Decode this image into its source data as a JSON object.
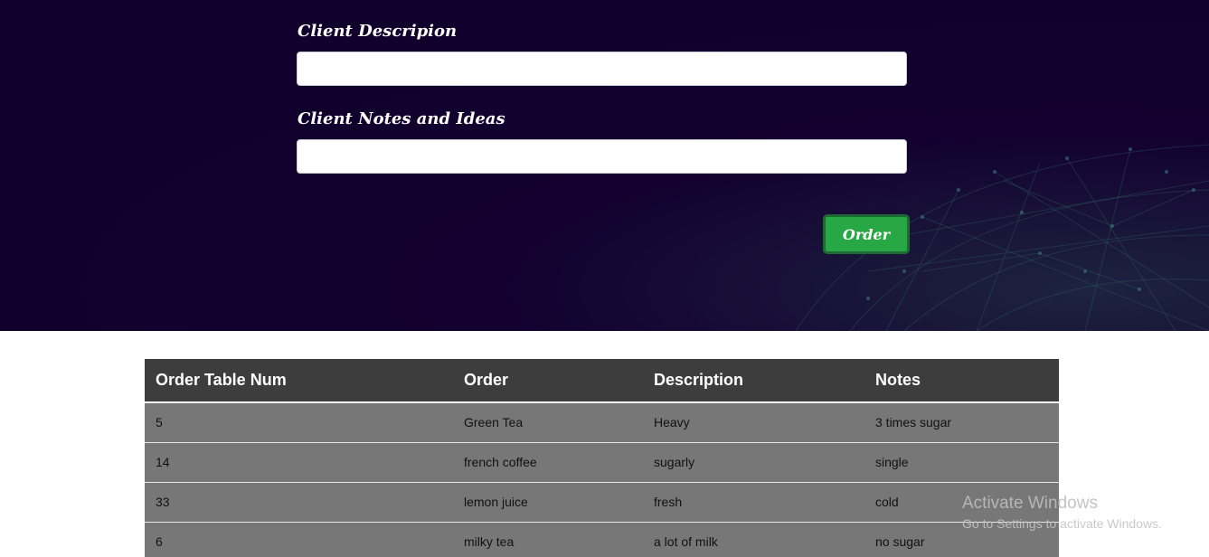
{
  "form": {
    "description_label": "Client Descripion",
    "description_value": "",
    "notes_label": "Client Notes and Ideas",
    "notes_value": "",
    "order_button": "Order"
  },
  "table": {
    "headers": [
      "Order Table Num",
      "Order",
      "Description",
      "Notes"
    ],
    "rows": [
      [
        "5",
        "Green Tea",
        "Heavy",
        "3 times sugar"
      ],
      [
        "14",
        "french coffee",
        "sugarly",
        "single"
      ],
      [
        "33",
        "lemon juice",
        "fresh",
        "cold"
      ],
      [
        "6",
        "milky tea",
        "a lot of milk",
        "no sugar"
      ]
    ]
  },
  "watermark": {
    "title": "Activate Windows",
    "subtitle": "Go to Settings to activate Windows."
  },
  "colors": {
    "hero_background": "#11002c",
    "order_button": "#28a745",
    "table_header": "#3d3d3d",
    "table_row": "#777777"
  },
  "icons": {
    "hero_decoration": "globe-network-icon"
  }
}
